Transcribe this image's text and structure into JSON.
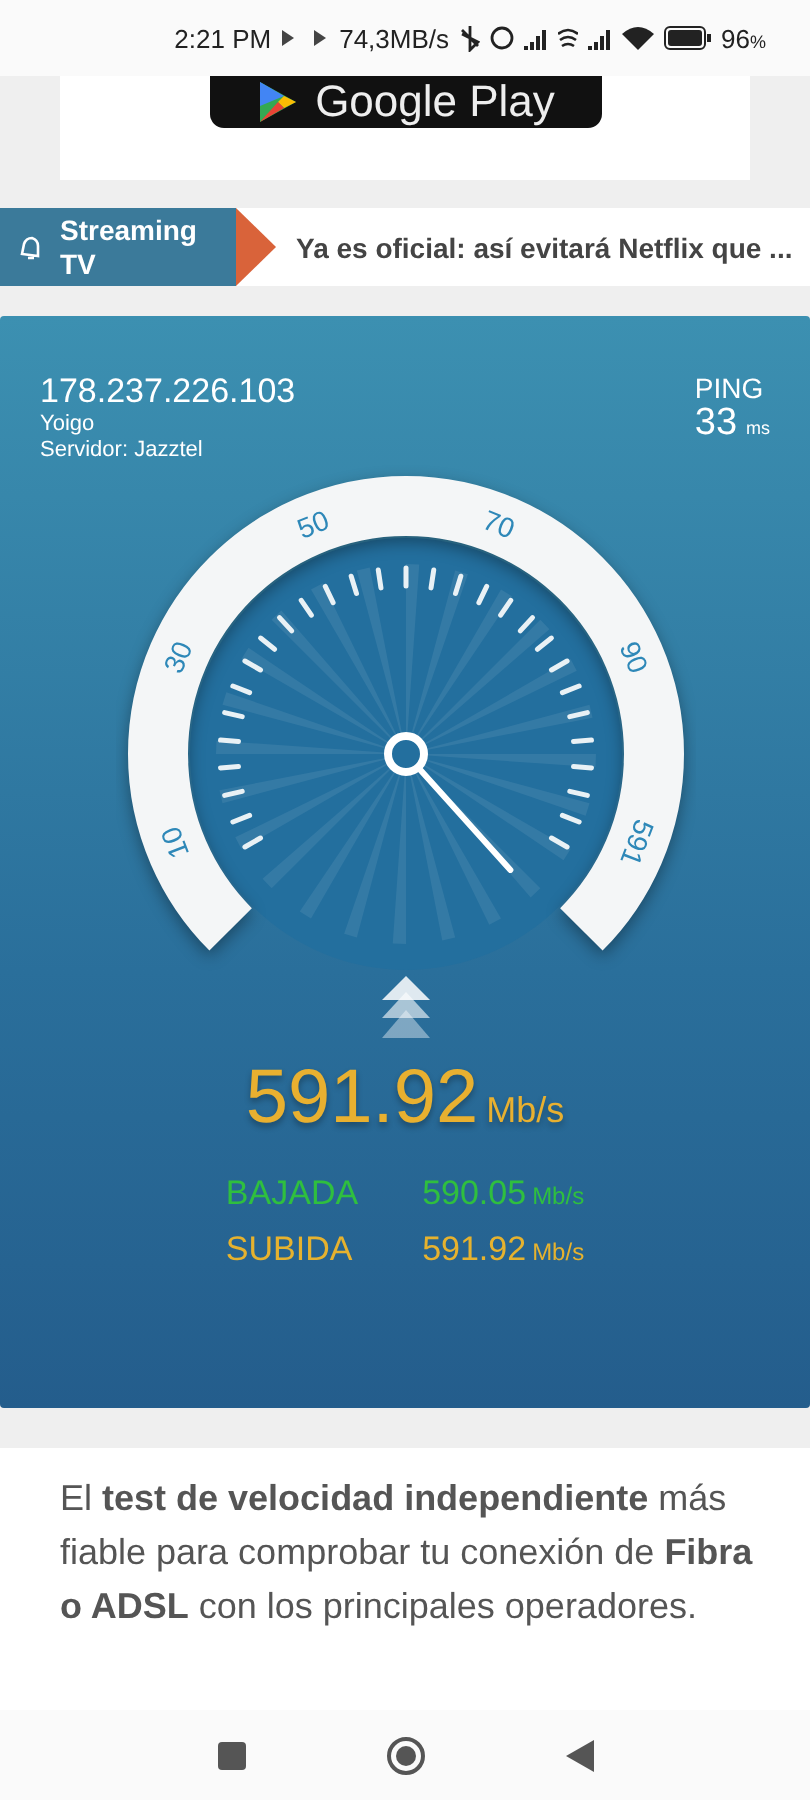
{
  "status_bar": {
    "time": "2:21 PM",
    "speed": "74,3MB/s",
    "battery": "96",
    "battery_unit": "%"
  },
  "ad": {
    "label": "Google Play"
  },
  "ticker": {
    "category": "Streaming TV",
    "headline": "Ya es oficial: así evitará Netflix que ..."
  },
  "speed_test": {
    "ip": "178.237.226.103",
    "operator": "Yoigo",
    "server": "Servidor: Jazztel",
    "ping_label": "PING",
    "ping_value": "33",
    "ping_unit": "ms",
    "gauge": {
      "labels": [
        "10",
        "30",
        "50",
        "70",
        "90",
        "591"
      ]
    },
    "result_value": "591.92",
    "result_unit": "Mb/s",
    "rows": [
      {
        "label": "BAJADA",
        "value": "590.05",
        "unit": "Mb/s",
        "color": "#2fbf3f"
      },
      {
        "label": "SUBIDA",
        "value": "591.92",
        "unit": "Mb/s",
        "color": "#e6b22e"
      }
    ]
  },
  "description": "El **test de velocidad independiente** más fiable para comprobar tu conexión de **Fibra o ADSL** con los principales operadores."
}
